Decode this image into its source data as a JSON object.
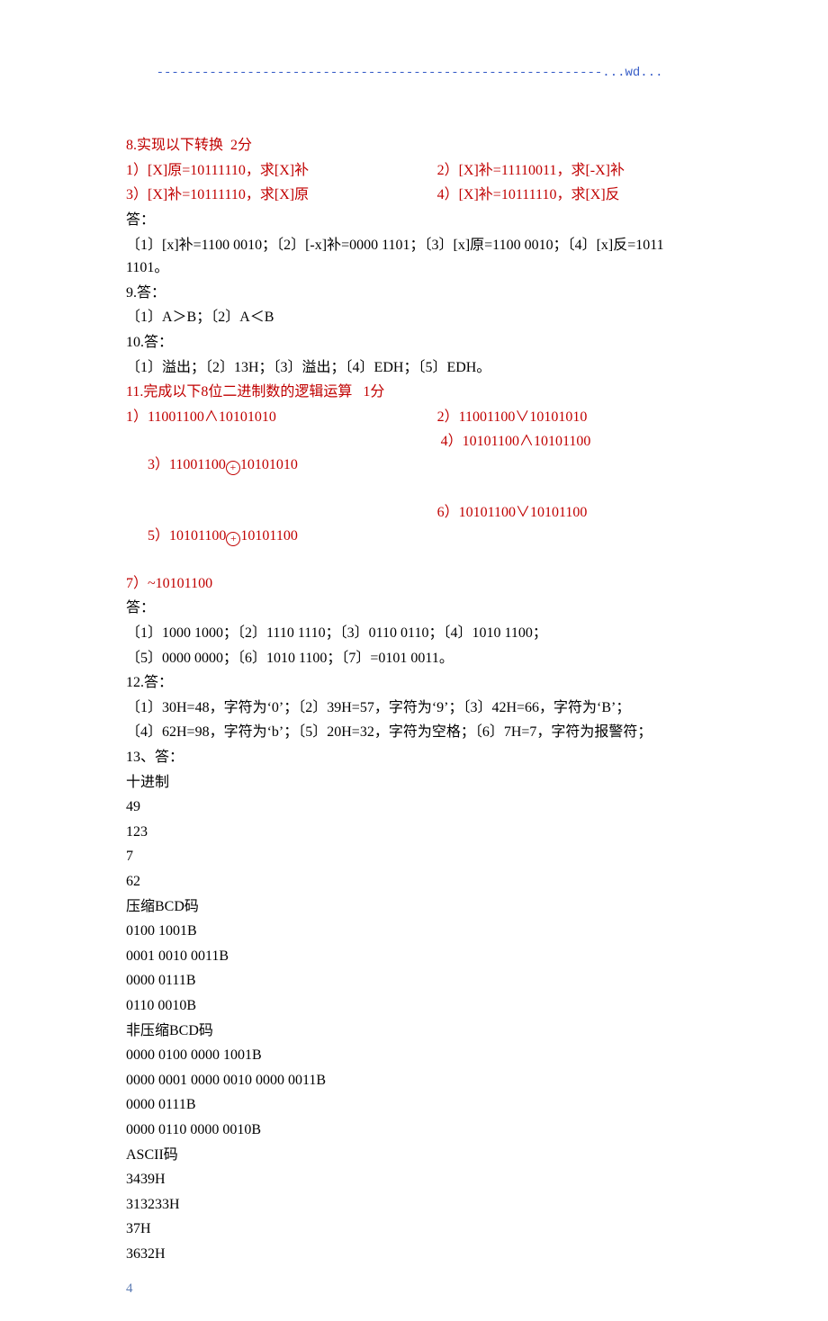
{
  "header": {
    "dashes": "-----------------------------------------------------------",
    "wd": "...wd..."
  },
  "q8": {
    "title": "8.实现以下转换  2分",
    "r1L": "1）[X]原=10111110，求[X]补",
    "r1R": "2）[X]补=11110011，求[-X]补",
    "r2L": "3）[X]补=10111110，求[X]原",
    "r2R": "4）[X]补=10111110，求[X]反",
    "ansLabel": "答：",
    "ans": "〔1〕[x]补=1100 0010；〔2〕[-x]补=0000 1101；〔3〕[x]原=1100 0010；〔4〕[x]反=1011 1101。"
  },
  "q9": {
    "label": "9.答：",
    "ans": "〔1〕A＞B；〔2〕A＜B"
  },
  "q10": {
    "label": "10.答：",
    "ans": "〔1〕溢出；〔2〕13H；〔3〕溢出；〔4〕EDH；〔5〕EDH。"
  },
  "q11": {
    "title": "11.完成以下8位二进制数的逻辑运算   1分",
    "r1L": "1）11001100∧10101010",
    "r1R": "2）11001100∨10101010",
    "r2L_a": "3）11001100",
    "r2L_b": "10101010",
    "r2R": " 4）10101100∧10101100",
    "r3L_a": "5）10101100",
    "r3L_b": "10101100",
    "r3R": "6）10101100∨10101100",
    "r4": "7）~10101100",
    "ansLabel": "答：",
    "ans1": "〔1〕1000 1000；〔2〕1110 1110；〔3〕0110 0110；〔4〕1010 1100；",
    "ans2": "〔5〕0000 0000；〔6〕1010 1100；〔7〕=0101 0011。"
  },
  "q12": {
    "label": "12.答：",
    "a1": "〔1〕30H=48，字符为‘0’；〔2〕39H=57，字符为‘9’；〔3〕42H=66，字符为‘B’；",
    "a2": "〔4〕62H=98，字符为‘b’；〔5〕20H=32，字符为空格；〔6〕7H=7，字符为报警符；"
  },
  "q13": {
    "label": "13、答：",
    "lines": [
      "十进制",
      "49",
      "123",
      "7",
      "62",
      "压缩BCD码",
      "0100 1001B",
      "0001 0010 0011B",
      "0000 0111B",
      "0110 0010B",
      "非压缩BCD码",
      "0000 0100 0000 1001B",
      "0000 0001 0000 0010 0000 0011B",
      "0000 0111B",
      "0000 0110 0000 0010B",
      "ASCII码",
      "3439H",
      "313233H",
      "37H",
      "3632H"
    ]
  },
  "pagenum": "4"
}
